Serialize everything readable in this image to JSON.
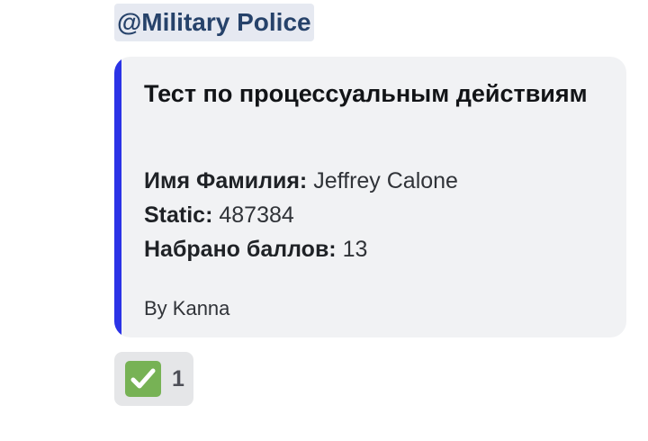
{
  "mention": {
    "text": "@Military Police"
  },
  "embed": {
    "accent_color": "#2b33e6",
    "title": "Тест по процессуальным действиям",
    "fields": [
      {
        "label": "Имя Фамилия:",
        "value": "Jeffrey Calone"
      },
      {
        "label": "Static:",
        "value": "487384"
      },
      {
        "label": "Набрано баллов:",
        "value": "13"
      }
    ],
    "footer": "By Kanna"
  },
  "reaction": {
    "icon": "white-heavy-check-mark-icon",
    "icon_color": "#77b255",
    "count": "1"
  }
}
